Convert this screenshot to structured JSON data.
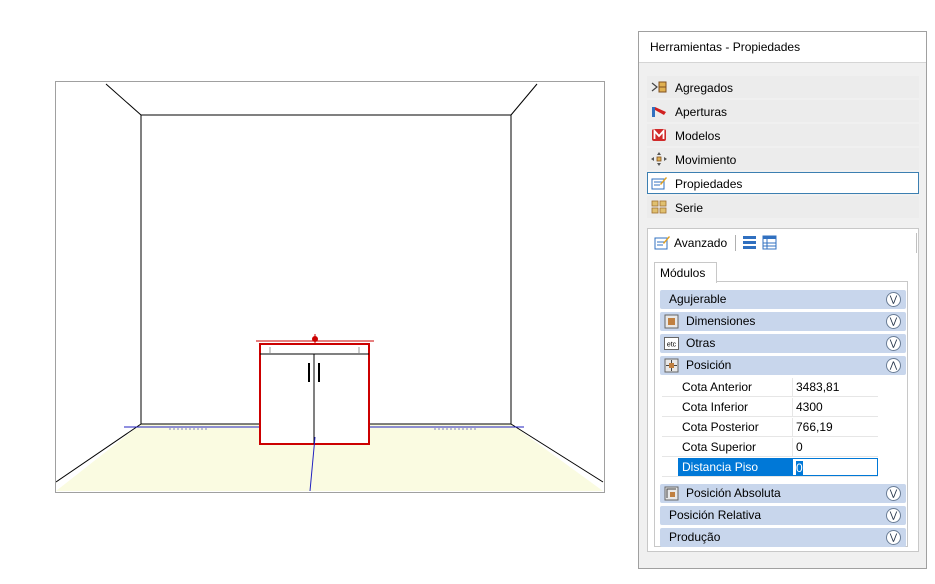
{
  "panel": {
    "title": "Herramientas - Propiedades",
    "tools": [
      {
        "label": "Agregados",
        "icon": "agregados-icon",
        "selected": false
      },
      {
        "label": "Aperturas",
        "icon": "aperturas-icon",
        "selected": false
      },
      {
        "label": "Modelos",
        "icon": "modelos-icon",
        "selected": false
      },
      {
        "label": "Movimiento",
        "icon": "movimiento-icon",
        "selected": false
      },
      {
        "label": "Propiedades",
        "icon": "propiedades-icon",
        "selected": true
      },
      {
        "label": "Serie",
        "icon": "serie-icon",
        "selected": false
      }
    ]
  },
  "advanced": {
    "label": "Avanzado",
    "tab": "Módulos",
    "sections": [
      {
        "label": "Agujerable",
        "icon": "",
        "expanded": false
      },
      {
        "label": "Dimensiones",
        "icon": "dimensiones-icon",
        "expanded": false
      },
      {
        "label": "Otras",
        "icon": "etc-icon",
        "expanded": false
      },
      {
        "label": "Posición",
        "icon": "posicion-icon",
        "expanded": true
      },
      {
        "label": "Posición Absoluta",
        "icon": "posicion-absoluta-icon",
        "expanded": false
      },
      {
        "label": "Posición Relativa",
        "icon": "",
        "expanded": false
      },
      {
        "label": "Produção",
        "icon": "",
        "expanded": false
      }
    ],
    "properties": [
      {
        "name": "Cota Anterior",
        "value": "3483,81"
      },
      {
        "name": "Cota Inferior",
        "value": "4300"
      },
      {
        "name": "Cota Posterior",
        "value": "766,19"
      },
      {
        "name": "Cota Superior",
        "value": "0"
      },
      {
        "name": "Distancia Piso",
        "value": "0",
        "active": true
      }
    ]
  },
  "colors": {
    "accent": "#0078d7",
    "section_header": "#c8d6ec",
    "floor": "#fafbe1",
    "cabinet_outline": "#cc0000",
    "axis_blue": "#2020c0"
  }
}
